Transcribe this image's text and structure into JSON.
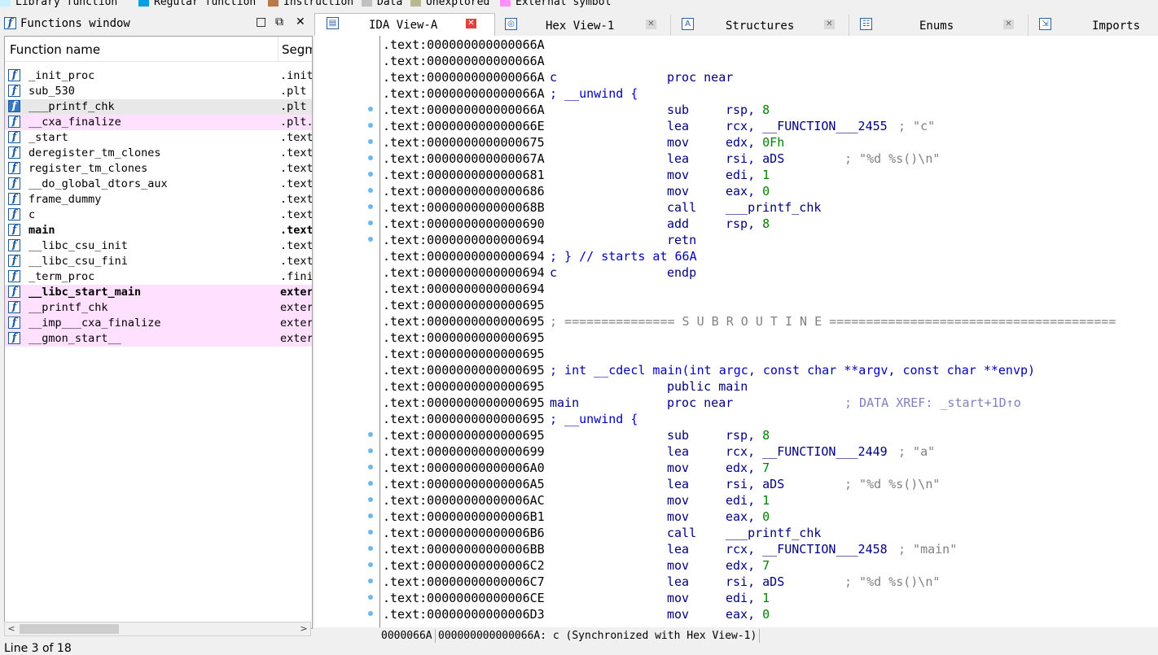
{
  "legend": [
    {
      "label": "Library function",
      "color": "#c8f0ff"
    },
    {
      "label": "Regular function",
      "color": "#00a0e0"
    },
    {
      "label": "Instruction",
      "color": "#b87848"
    },
    {
      "label": "Data",
      "color": "#c0c0c0"
    },
    {
      "label": "Unexplored",
      "color": "#b8b890"
    },
    {
      "label": "External symbol",
      "color": "#ff90ff"
    }
  ],
  "functions_window": {
    "title": "Functions window",
    "col_name": "Function name",
    "col_segment": "Segm",
    "status": "Line 3 of 18",
    "rows": [
      {
        "name": "_init_proc",
        "seg": ".init",
        "style": ""
      },
      {
        "name": "sub_530",
        "seg": ".plt",
        "style": ""
      },
      {
        "name": "___printf_chk",
        "seg": ".plt",
        "style": "sel"
      },
      {
        "name": "__cxa_finalize",
        "seg": ".plt.",
        "style": "lib"
      },
      {
        "name": "_start",
        "seg": ".text",
        "style": ""
      },
      {
        "name": "deregister_tm_clones",
        "seg": ".text",
        "style": ""
      },
      {
        "name": "register_tm_clones",
        "seg": ".text",
        "style": ""
      },
      {
        "name": "__do_global_dtors_aux",
        "seg": ".text",
        "style": ""
      },
      {
        "name": "frame_dummy",
        "seg": ".text",
        "style": ""
      },
      {
        "name": "c",
        "seg": ".text",
        "style": ""
      },
      {
        "name": "main",
        "seg": ".text",
        "style": "bold"
      },
      {
        "name": "__libc_csu_init",
        "seg": ".text",
        "style": ""
      },
      {
        "name": "__libc_csu_fini",
        "seg": ".text",
        "style": ""
      },
      {
        "name": "_term_proc",
        "seg": ".fini",
        "style": ""
      },
      {
        "name": "__libc_start_main",
        "seg": "exter",
        "style": "lib bold"
      },
      {
        "name": "__printf_chk",
        "seg": "exter",
        "style": "lib"
      },
      {
        "name": "__imp___cxa_finalize",
        "seg": "exter",
        "style": "lib"
      },
      {
        "name": "__gmon_start__",
        "seg": "exter",
        "style": "lib"
      }
    ]
  },
  "tabs": [
    {
      "label": "IDA View-A",
      "active": true
    },
    {
      "label": "Hex View-1",
      "active": false
    },
    {
      "label": "Structures",
      "active": false
    },
    {
      "label": "Enums",
      "active": false
    },
    {
      "label": "Imports",
      "active": false
    }
  ],
  "code": [
    {
      "addr": ".text:000000000000066A",
      "dot": false
    },
    {
      "addr": ".text:000000000000066A",
      "dot": false
    },
    {
      "addr": ".text:000000000000066A",
      "dot": false,
      "label": "c",
      "mn": "proc near"
    },
    {
      "addr": ".text:000000000000066A",
      "dot": false,
      "comment_blue": "; __unwind {"
    },
    {
      "addr": ".text:000000000000066A",
      "dot": true,
      "mn": "sub",
      "op": "rsp, 8"
    },
    {
      "addr": ".text:000000000000066E",
      "dot": true,
      "mn": "lea",
      "op": "rcx, __FUNCTION___2455",
      "cmt": "; \"c\""
    },
    {
      "addr": ".text:0000000000000675",
      "dot": true,
      "mn": "mov",
      "op": "edx, 0Fh"
    },
    {
      "addr": ".text:000000000000067A",
      "dot": true,
      "mn": "lea",
      "op": "rsi, aDS",
      "cmt": "; \"%d %s()\\n\""
    },
    {
      "addr": ".text:0000000000000681",
      "dot": true,
      "mn": "mov",
      "op": "edi, 1"
    },
    {
      "addr": ".text:0000000000000686",
      "dot": true,
      "mn": "mov",
      "op": "eax, 0"
    },
    {
      "addr": ".text:000000000000068B",
      "dot": true,
      "mn": "call",
      "op": "___printf_chk"
    },
    {
      "addr": ".text:0000000000000690",
      "dot": true,
      "mn": "add",
      "op": "rsp, 8"
    },
    {
      "addr": ".text:0000000000000694",
      "dot": true,
      "mn": "retn"
    },
    {
      "addr": ".text:0000000000000694",
      "dot": false,
      "comment_blue": "; } // starts at 66A"
    },
    {
      "addr": ".text:0000000000000694",
      "dot": false,
      "label": "c",
      "mn": "endp"
    },
    {
      "addr": ".text:0000000000000694",
      "dot": false
    },
    {
      "addr": ".text:0000000000000695",
      "dot": false
    },
    {
      "addr": ".text:0000000000000695",
      "dot": false,
      "comment_gray": "; =============== S U B R O U T I N E ======================================="
    },
    {
      "addr": ".text:0000000000000695",
      "dot": false
    },
    {
      "addr": ".text:0000000000000695",
      "dot": false
    },
    {
      "addr": ".text:0000000000000695",
      "dot": false,
      "comment_blue": "; int __cdecl main(int argc, const char **argv, const char **envp)"
    },
    {
      "addr": ".text:0000000000000695",
      "dot": false,
      "mn": "public main"
    },
    {
      "addr": ".text:0000000000000695",
      "dot": false,
      "label": "main",
      "mn": "proc near",
      "xref": "; DATA XREF: _start+1D↑o"
    },
    {
      "addr": ".text:0000000000000695",
      "dot": false,
      "comment_blue": "; __unwind {"
    },
    {
      "addr": ".text:0000000000000695",
      "dot": true,
      "mn": "sub",
      "op": "rsp, 8"
    },
    {
      "addr": ".text:0000000000000699",
      "dot": true,
      "mn": "lea",
      "op": "rcx, __FUNCTION___2449",
      "cmt": "; \"a\""
    },
    {
      "addr": ".text:00000000000006A0",
      "dot": true,
      "mn": "mov",
      "op": "edx, 7"
    },
    {
      "addr": ".text:00000000000006A5",
      "dot": true,
      "mn": "lea",
      "op": "rsi, aDS",
      "cmt": "; \"%d %s()\\n\""
    },
    {
      "addr": ".text:00000000000006AC",
      "dot": true,
      "mn": "mov",
      "op": "edi, 1"
    },
    {
      "addr": ".text:00000000000006B1",
      "dot": true,
      "mn": "mov",
      "op": "eax, 0"
    },
    {
      "addr": ".text:00000000000006B6",
      "dot": true,
      "mn": "call",
      "op": "___printf_chk"
    },
    {
      "addr": ".text:00000000000006BB",
      "dot": true,
      "mn": "lea",
      "op": "rcx, __FUNCTION___2458",
      "cmt": "; \"main\""
    },
    {
      "addr": ".text:00000000000006C2",
      "dot": true,
      "mn": "mov",
      "op": "edx, 7"
    },
    {
      "addr": ".text:00000000000006C7",
      "dot": true,
      "mn": "lea",
      "op": "rsi, aDS",
      "cmt": "; \"%d %s()\\n\""
    },
    {
      "addr": ".text:00000000000006CE",
      "dot": true,
      "mn": "mov",
      "op": "edi, 1"
    },
    {
      "addr": ".text:00000000000006D3",
      "dot": true,
      "mn": "mov",
      "op": "eax, 0"
    }
  ],
  "bottom_status": {
    "offset": "0000066A",
    "location": "000000000000066A: c (Synchronized with Hex View-1)"
  }
}
